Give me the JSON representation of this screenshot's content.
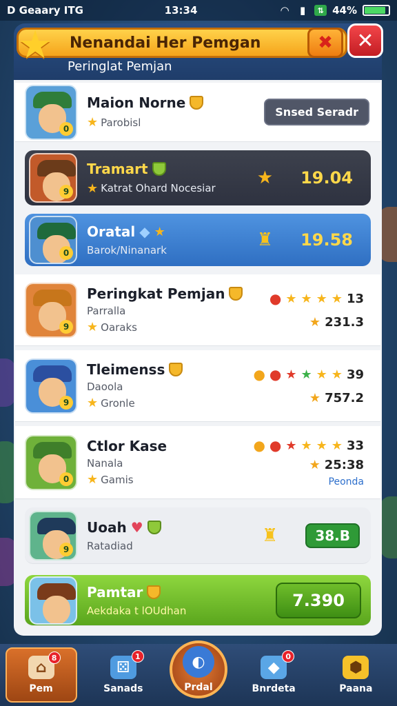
{
  "status_bar": {
    "carrier": "D Geaary ITG",
    "time": "13:34",
    "battery": "44%"
  },
  "header": {
    "title": "Nenandai Her Pemgan",
    "subtitle": "Peringlat Pemjan"
  },
  "rows": [
    {
      "name": "Maion Norne",
      "sub": "Parobisl",
      "action": "Snsed Seradr",
      "hat_color": "#2f7d3a"
    },
    {
      "name": "Tramart",
      "sub": "Katrat Ohard Nocesiar",
      "score": "19.04",
      "hat_color": "#6b3b1a"
    },
    {
      "name": "Oratal",
      "sub": "Barok/Ninanark",
      "score": "19.58",
      "hat_color": "#1f6a3b"
    },
    {
      "name": "Peringkat Pemjan",
      "sub": "Parralla",
      "sub2": "Oaraks",
      "stars_value": "13",
      "value": "231.3",
      "hat_color": "#c7761b"
    },
    {
      "name": "Tleimenss",
      "sub": "Daoola",
      "sub2": "Gronle",
      "stars_value": "39",
      "value": "757.2",
      "hat_color": "#2b4fa0"
    },
    {
      "name": "Ctlor Kase",
      "sub": "Nanala",
      "sub2": "Gamis",
      "stars_value": "33",
      "value": "25:38",
      "value_sub": "Peonda",
      "hat_color": "#3f7f2a"
    },
    {
      "name": "Uoah",
      "sub": "Ratadiad",
      "green_value": "38.B",
      "hat_color": "#1f3a5a"
    },
    {
      "name": "Pamtar",
      "sub": "Aekdaka t lOUdhan",
      "green_value": "7.390",
      "hat_color": "#7a3b1a"
    }
  ],
  "nav": [
    {
      "label": "Pem",
      "badge": "8"
    },
    {
      "label": "Sanads",
      "badge": "1"
    },
    {
      "label": "Prdal"
    },
    {
      "label": "Bnrdeta",
      "badge": "0"
    },
    {
      "label": "Paana"
    }
  ]
}
